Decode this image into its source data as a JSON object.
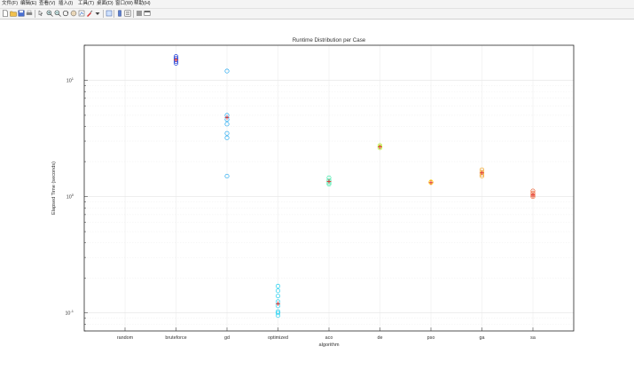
{
  "window": {
    "menus": [
      "文件(F)",
      "编辑(E)",
      "查看(V)",
      "插入(I)",
      "工具(T)",
      "桌面(D)",
      "窗口(W)",
      "帮助(H)"
    ],
    "toolbar_icons": [
      "new-file-icon",
      "open-folder-icon",
      "save-icon",
      "print-icon",
      "pointer-icon",
      "zoom-in-icon",
      "zoom-out-icon",
      "rotate-icon",
      "pan-icon",
      "data-cursor-icon",
      "brush-icon",
      "link-plot-icon",
      "colorbar-icon",
      "legend-icon",
      "hide-tools-icon",
      "dock-figure-icon"
    ]
  },
  "chart_data": {
    "type": "scatter",
    "title": "Runtime Distribution per Case",
    "xlabel": "algorithm",
    "ylabel": "Elapsed Time (seconds)",
    "yscale": "log",
    "ylim": [
      0.07,
      20
    ],
    "y_ticks": [
      {
        "label": "10",
        "exp": "-1",
        "value": 0.1
      },
      {
        "label": "10",
        "exp": "0",
        "value": 1
      },
      {
        "label": "10",
        "exp": "1",
        "value": 10
      }
    ],
    "grid": true,
    "categories": [
      "random",
      "bruteforce",
      "gd",
      "optimized",
      "aco",
      "de",
      "pso",
      "ga",
      "sa"
    ],
    "series": [
      {
        "category": "random",
        "color": "#1f3fd8",
        "values": [],
        "median": null
      },
      {
        "category": "bruteforce",
        "color": "#1f3fd8",
        "values": [
          14.0,
          14.5,
          15.0,
          15.5,
          16.0
        ],
        "median": 15.0
      },
      {
        "category": "gd",
        "color": "#22a8f0",
        "values": [
          12.0,
          5.0,
          4.6,
          4.2,
          3.5,
          3.2,
          1.5
        ],
        "median": 4.8
      },
      {
        "category": "optimized",
        "color": "#22d0f0",
        "values": [
          0.17,
          0.155,
          0.14,
          0.125,
          0.115,
          0.103,
          0.1,
          0.095
        ],
        "median": 0.12
      },
      {
        "category": "aco",
        "color": "#3ee8a8",
        "values": [
          1.45,
          1.38,
          1.32,
          1.28
        ],
        "median": 1.35
      },
      {
        "category": "de",
        "color": "#b8ea3a",
        "values": [
          2.75,
          2.68,
          2.62
        ],
        "median": 2.68
      },
      {
        "category": "pso",
        "color": "#ffd21a",
        "values": [
          1.34,
          1.32
        ],
        "median": 1.32
      },
      {
        "category": "ga",
        "color": "#f0a020",
        "values": [
          1.7,
          1.62,
          1.55,
          1.5
        ],
        "median": 1.6
      },
      {
        "category": "sa",
        "color": "#ec5a28",
        "values": [
          1.12,
          1.07,
          1.03,
          1.0
        ],
        "median": 1.03
      }
    ]
  }
}
